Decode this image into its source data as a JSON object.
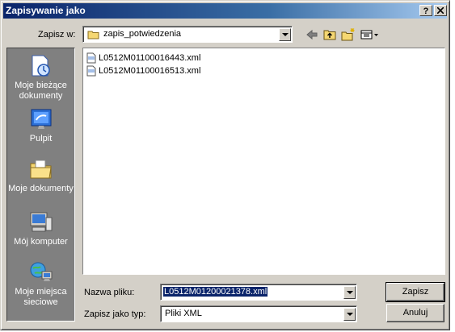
{
  "window": {
    "title": "Zapisywanie jako",
    "help_btn": "?",
    "close_btn": "X"
  },
  "location": {
    "label": "Zapisz w:",
    "value": "zapis_potwiedzenia"
  },
  "places": [
    {
      "label": "Moje bieżące dokumenty"
    },
    {
      "label": "Pulpit"
    },
    {
      "label": "Moje dokumenty"
    },
    {
      "label": "Mój komputer"
    },
    {
      "label": "Moje miejsca sieciowe"
    }
  ],
  "files": [
    {
      "name": "L0512M01100016443.xml"
    },
    {
      "name": "L0512M01100016513.xml"
    }
  ],
  "filename": {
    "label": "Nazwa pliku:",
    "value": "L0512M01200021378.xml"
  },
  "filetype": {
    "label": "Zapisz jako typ:",
    "value": "Pliki XML"
  },
  "buttons": {
    "save": "Zapisz",
    "cancel": "Anuluj"
  }
}
